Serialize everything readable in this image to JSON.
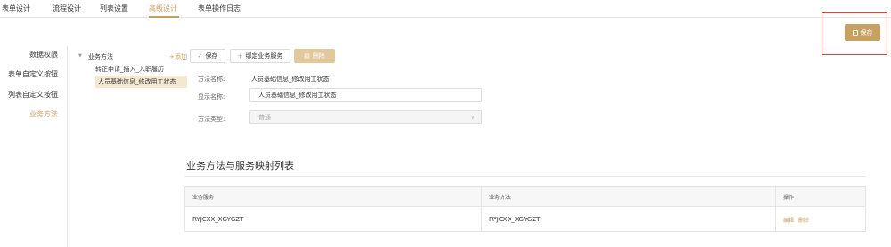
{
  "top_tabs": [
    {
      "label": "表单设计"
    },
    {
      "label": "流程设计"
    },
    {
      "label": "列表设置"
    },
    {
      "label": "高级设计",
      "active": true
    },
    {
      "label": "表单操作日志"
    }
  ],
  "header": {
    "save_label": "保存"
  },
  "left_nav": {
    "items": [
      {
        "label": "数据权限"
      },
      {
        "label": "表单自定义按钮"
      },
      {
        "label": "列表自定义按钮"
      },
      {
        "label": "业务方法",
        "active": true
      }
    ]
  },
  "tree": {
    "root_label": "业务方法",
    "add_label": "+添加",
    "children": [
      {
        "label": "转正申请_插入_入职履历"
      },
      {
        "label": "人员基础信息_修改用工状态",
        "selected": true
      }
    ]
  },
  "toolbar": {
    "save_label": "保存",
    "bind_label": "绑定业务服务",
    "delete_label": "删除"
  },
  "form": {
    "method_name_label": "方法名称:",
    "method_name_value": "人员基础信息_修改用工状态",
    "display_name_label": "显示名称:",
    "display_name_value": "人员基础信息_修改用工状态",
    "method_type_label": "方法类型:",
    "method_type_value": "普通"
  },
  "mapping": {
    "title": "业务方法与服务映射列表",
    "columns": [
      "业务服务",
      "业务方法",
      "操作"
    ],
    "rows": [
      {
        "service": "RYJCXX_XGYGZT",
        "method": "RYJCXX_XGYGZT",
        "edit": "编辑",
        "delete": "删除"
      }
    ]
  },
  "colors": {
    "accent": "#c8a063",
    "highlight_border": "#e8413a"
  }
}
